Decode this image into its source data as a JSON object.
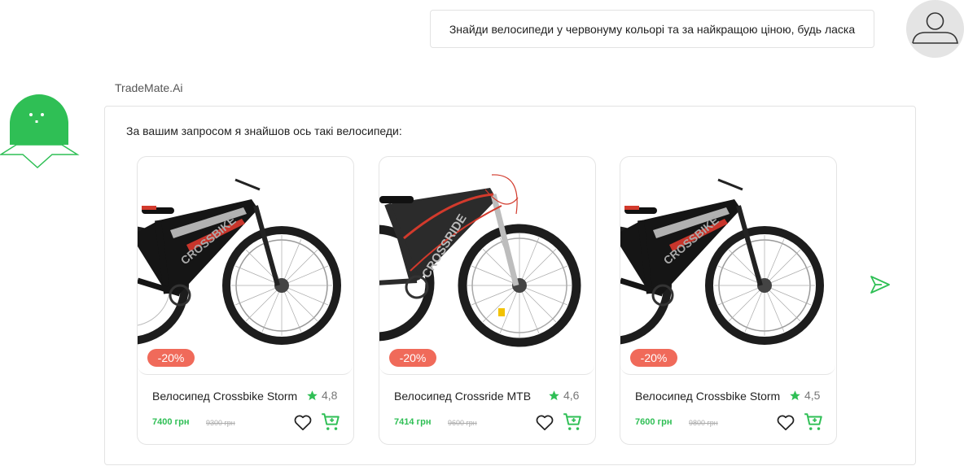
{
  "user": {
    "message": "Знайди велосипеди у червонуму кольорі та за найкращою ціною, будь ласка",
    "avatar_icon": "user-icon"
  },
  "bot": {
    "name": "TradeMate.Ai",
    "avatar_icon": "ghost-mascot-icon",
    "intro": "За вашим запросом я знайшов ось такі велосипеди:",
    "accent": "#2fbf55"
  },
  "products": [
    {
      "title": "Велосипед Crossbike Storm",
      "rating": "4,8",
      "price": "7400 грн",
      "old_price": "9300 грн",
      "discount": "-20%",
      "brand_text": "CROSSBIKE"
    },
    {
      "title": "Велосипед Crossride MTB",
      "rating": "4,6",
      "price": "7414 грн",
      "old_price": "9600 грн",
      "discount": "-20%",
      "brand_text": "CROSSRIDE"
    },
    {
      "title": "Велосипед Crossbike Storm",
      "rating": "4,5",
      "price": "7600 грн",
      "old_price": "9800 грн",
      "discount": "-20%",
      "brand_text": "CROSSBIKE"
    }
  ],
  "colors": {
    "discount_badge": "#f06a5a",
    "price": "#2fbf55",
    "star": "#2fbf55",
    "border": "#e3e3e3"
  },
  "icons": {
    "favorite": "heart-icon",
    "cart": "cart-icon",
    "rating": "star-icon",
    "next": "send-arrow-icon"
  }
}
